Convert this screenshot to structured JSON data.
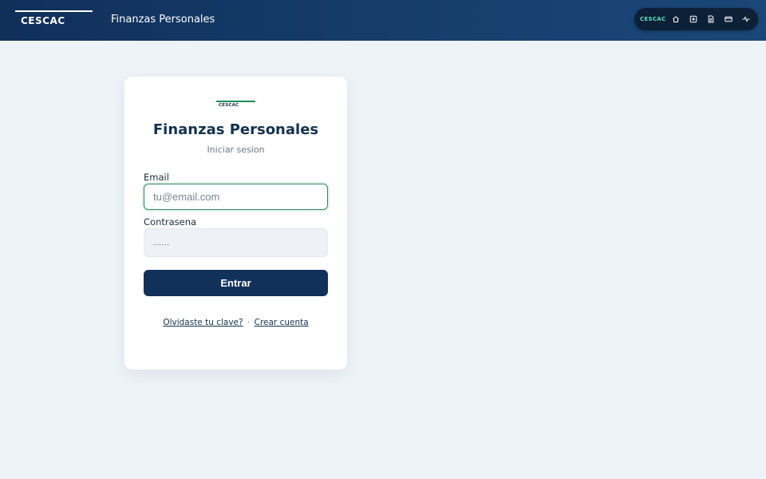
{
  "header": {
    "brand": "CESCAC",
    "title": "Finanzas Personales"
  },
  "dock": {
    "brand": "CESCAC",
    "items": [
      {
        "icon": "home-icon"
      },
      {
        "icon": "add-icon"
      },
      {
        "icon": "document-icon"
      },
      {
        "icon": "card-icon"
      },
      {
        "icon": "activity-icon"
      }
    ]
  },
  "login": {
    "logo_text": "CESCAC",
    "title": "Finanzas Personales",
    "subtitle": "Iniciar sesion",
    "email_label": "Email",
    "email_placeholder": "tu@email.com",
    "email_value": "",
    "password_label": "Contrasena",
    "password_value": "......",
    "submit_label": "Entrar",
    "forgot_link": "Olvidaste tu clave?",
    "separator": "·",
    "signup_link": "Crear cuenta"
  },
  "colors": {
    "header_bg": "#10305a",
    "accent": "#2e8a60",
    "button_bg": "#12315a",
    "page_bg": "#eef3f8"
  }
}
